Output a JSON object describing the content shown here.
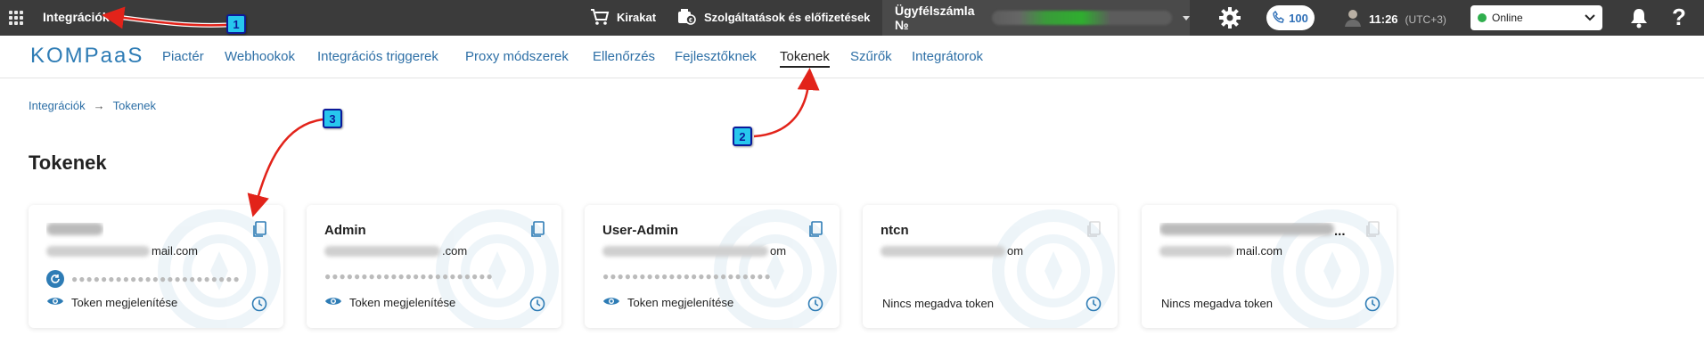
{
  "topbar": {
    "app_title": "Integrációk",
    "showcase_label": "Kirakat",
    "services_label": "Szolgáltatások és előfizetések",
    "account_label": "Ügyfélszámla №",
    "phone_count": "100",
    "time": "11:26",
    "timezone": "(UTC+3)",
    "status": "Online",
    "help": "?"
  },
  "logo": {
    "text": "KOMPaaS",
    "color": "#2e7cb5"
  },
  "nav": {
    "items": [
      {
        "label": "Piactér"
      },
      {
        "label": "Webhookok"
      },
      {
        "label": "Integrációs triggerek"
      },
      {
        "label": "Proxy módszerek"
      },
      {
        "label": "Ellenőrzés"
      },
      {
        "label": "Fejlesztőknek"
      },
      {
        "label": "Tokenek",
        "active": true
      },
      {
        "label": "Szűrők"
      },
      {
        "label": "Integrátorok"
      }
    ]
  },
  "breadcrumb": {
    "root": "Integrációk",
    "separator": "→",
    "current": "Tokenek"
  },
  "page_title": "Tokenek",
  "cards": [
    {
      "name": "",
      "email_suffix": "mail.com",
      "token_dots": "●●●●●●●●●●●●●●●●●●●●●●●",
      "show_label": "Token megjelenítése"
    },
    {
      "name": "Admin",
      "email_suffix": ".com",
      "token_dots": "●●●●●●●●●●●●●●●●●●●●●●●",
      "show_label": "Token megjelenítése"
    },
    {
      "name": "User-Admin",
      "email_suffix": "om",
      "token_dots": "●●●●●●●●●●●●●●●●●●●●●●●",
      "show_label": "Token megjelenítése"
    },
    {
      "name": "ntcn",
      "email_suffix": "om",
      "no_token_label": "Nincs megadva token"
    },
    {
      "name": "...",
      "email_suffix": "mail.com",
      "no_token_label": "Nincs megadva token"
    }
  ],
  "annotations": {
    "badge1": "1",
    "badge2": "2",
    "badge3": "3"
  },
  "colors": {
    "topbar": "#3b3b3b",
    "accent": "#2e7cb5",
    "link": "#2d6fa6",
    "annotation_arrow": "#e2231a",
    "annotation_badge": "#27c7ee"
  }
}
